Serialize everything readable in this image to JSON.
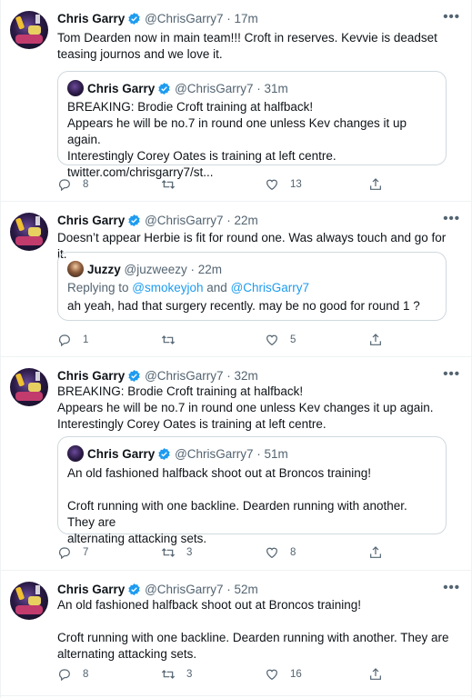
{
  "tweets": [
    {
      "author": "Chris Garry",
      "handle": "@ChrisGarry7",
      "time": "17m",
      "text": "Tom Dearden now in main team!!! Croft in reserves. Kevvie is deadset\nteasing journos and we love it.",
      "quote": {
        "author": "Chris Garry",
        "handle": "@ChrisGarry7",
        "time": "31m",
        "text": "BREAKING: Brodie Croft training at halfback!\nAppears he will be no.7 in round one unless Kev changes it up again.\nInterestingly Corey Oates is training at left centre.\ntwitter.com/chrisgarry7/st..."
      },
      "replies": "8",
      "retweets": "",
      "likes": "13"
    },
    {
      "author": "Chris Garry",
      "handle": "@ChrisGarry7",
      "time": "22m",
      "text": "Doesn’t appear Herbie is fit for round one. Was always touch and go for it.",
      "quote": {
        "author": "Juzzy",
        "handle": "@juzweezy",
        "time": "22m",
        "replying_prefix": "Replying to ",
        "replying_user1": "@smokeyjoh",
        "replying_and": " and ",
        "replying_user2": "@ChrisGarry7",
        "text": "ah yeah, had that surgery recently. may be no good for round 1 ?"
      },
      "replies": "1",
      "retweets": "",
      "likes": "5"
    },
    {
      "author": "Chris Garry",
      "handle": "@ChrisGarry7",
      "time": "32m",
      "text": "BREAKING: Brodie Croft training at halfback!\nAppears he will be no.7 in round one unless Kev changes it up again.\nInterestingly Corey Oates is training at left centre.",
      "quote": {
        "author": "Chris Garry",
        "handle": "@ChrisGarry7",
        "time": "51m",
        "text": "An old fashioned halfback shoot out at Broncos training!\n\nCroft running with one backline. Dearden running with another. They are\nalternating attacking sets."
      },
      "replies": "7",
      "retweets": "3",
      "likes": "8"
    },
    {
      "author": "Chris Garry",
      "handle": "@ChrisGarry7",
      "time": "52m",
      "text": "An old fashioned halfback shoot out at Broncos training!\n\nCroft running with one backline. Dearden running with another. They are\nalternating attacking sets.",
      "replies": "8",
      "retweets": "3",
      "likes": "16"
    }
  ],
  "separator": " · ",
  "more_glyph": "•••",
  "colors": {
    "verified": "#1d9bf0",
    "secondary_text": "#536471",
    "border": "#cfd9de"
  }
}
